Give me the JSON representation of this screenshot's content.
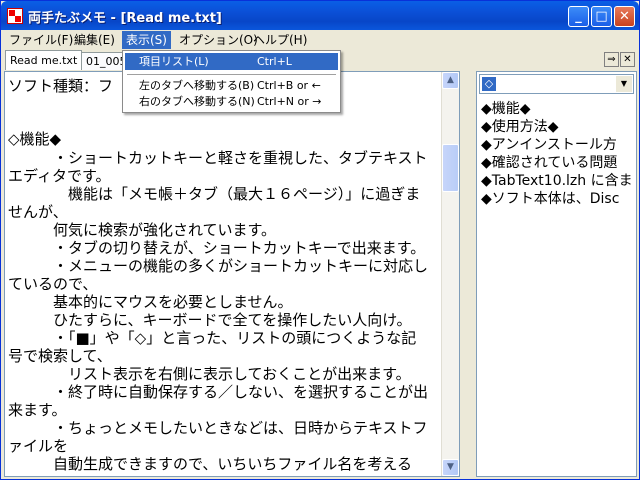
{
  "window": {
    "title": "両手たぶメモ - [Read me.txt]"
  },
  "title_buttons": {
    "minimize": "_",
    "maximize": "□",
    "close": "✕"
  },
  "menubar": {
    "items": [
      {
        "label": "ファイル(F)"
      },
      {
        "label": "編集(E)"
      },
      {
        "label": "表示(S)"
      },
      {
        "label": "オプション(O)"
      },
      {
        "label": "ヘルプ(H)"
      }
    ]
  },
  "tabs": {
    "items": [
      {
        "label": "Read me.txt"
      },
      {
        "label": "01_005."
      }
    ],
    "nav_right": "⇒",
    "close": "✕"
  },
  "view_menu": {
    "items": [
      {
        "label": "項目リスト(L)",
        "shortcut": "Ctrl+L"
      },
      {
        "label": "左のタブへ移動する(B)",
        "shortcut": "Ctrl+B or ←"
      },
      {
        "label": "右のタブへ移動する(N)",
        "shortcut": "Ctrl+N or →"
      }
    ]
  },
  "editor": {
    "lines": [
      "ソフト種類：フ",
      "",
      "◇機能◆",
      "　　　・ショートカットキーと軽さを重視した、タブテキスト",
      "エディタです。",
      "　　　　機能は「メモ帳＋タブ（最大１６ページ）」に過ぎま",
      "せんが、",
      "　　　何気に検索が強化されています。",
      "　　　・タブの切り替えが、ショートカットキーで出来ます。",
      "　　　・メニューの機能の多くがショートカットキーに対応し",
      "ているので、",
      "　　　基本的にマウスを必要としません。",
      "　　　ひたすらに、キーボードで全てを操作したい人向け。",
      "　　　・「■」や「◇」と言った、リストの頭につくような記",
      "号で検索して、",
      "　　　　リスト表示を右側に表示しておくことが出来ます。",
      "　　　・終了時に自動保存する／しない、を選択することが出",
      "来ます。",
      "　　　・ちょっとメモしたいときなどは、日時からテキストフ",
      "ァイルを",
      "　　　自動生成できますので、いちいちファイル名を考える"
    ]
  },
  "sidepanel": {
    "combo_value": "◇",
    "items": [
      "◆機能◆",
      "◆使用方法◆",
      "◆アンインストール方",
      "◆確認されている問題",
      "◆TabText10.lzh に含ま",
      "◆ソフト本体は、Disc"
    ]
  },
  "colors": {
    "title_bar": "#0a56dc",
    "menu_highlight": "#316ac5"
  }
}
